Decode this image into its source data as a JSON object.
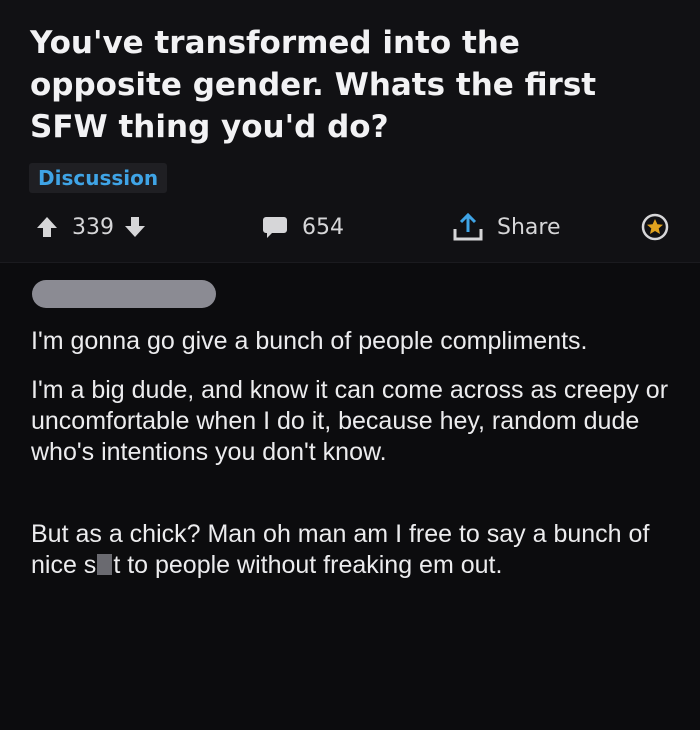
{
  "post": {
    "title": "You've transformed into the opposite gender. Whats the first SFW thing you'd do?",
    "flair": "Discussion",
    "upvotes": "339",
    "comments": "654",
    "share_label": "Share"
  },
  "comment": {
    "author": "",
    "paragraph_1": "I'm gonna go give a bunch of people compliments.",
    "paragraph_2": "I'm a big dude, and know it can come across as creepy or uncomfortable when I do it, because hey, random dude who's intentions you don't know.",
    "paragraph_3_before": "But as a chick? Man oh man am I free to say a bunch of nice s",
    "paragraph_3_after": "t to people without freaking em out."
  },
  "icons": {
    "upvote": "arrow-up-icon",
    "downvote": "arrow-down-icon",
    "comments": "speech-bubble-icon",
    "share": "share-upload-icon",
    "award": "award-icon"
  },
  "colors": {
    "background": "#0c0c0e",
    "post_background": "#111114",
    "flair_text": "#3fa4e6",
    "text": "#ececee"
  }
}
